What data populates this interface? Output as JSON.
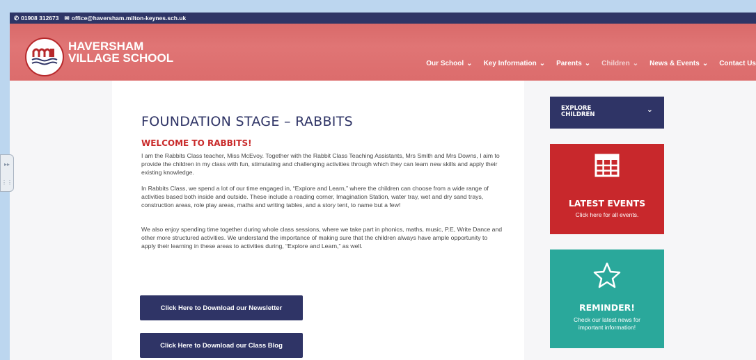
{
  "topbar": {
    "phone": "01908 312673",
    "email": "office@haversham.milton-keynes.sch.uk"
  },
  "header": {
    "school_line1": "HAVERSHAM",
    "school_line2": "VILLAGE SCHOOL"
  },
  "nav": {
    "items": [
      {
        "label": "Our School",
        "has_dropdown": true
      },
      {
        "label": "Key Information",
        "has_dropdown": true
      },
      {
        "label": "Parents",
        "has_dropdown": true
      },
      {
        "label": "Children",
        "has_dropdown": true
      },
      {
        "label": "News & Events",
        "has_dropdown": true
      },
      {
        "label": "Contact Us",
        "has_dropdown": false
      }
    ]
  },
  "main": {
    "title": "FOUNDATION STAGE – RABBITS",
    "welcome_heading": "WELCOME TO RABBITS!",
    "paragraphs": [
      "I am the Rabbits Class teacher, Miss McEvoy. Together with the Rabbit Class Teaching Assistants, Mrs Smith and Mrs Downs, I aim to provide the children in my class with fun, stimulating and challenging activities through which they can learn new skills and apply their existing knowledge.",
      "In Rabbits Class, we spend a lot of our time engaged in, “Explore and Learn,” where the children can choose from a wide range of activities based both inside and outside. These include a reading corner, Imagination Station, water tray, wet and dry sand trays, construction areas, role play areas, maths and writing tables, and a story tent, to name but a few!",
      "We also enjoy spending time together during whole class sessions, where we take part in phonics, maths, music, P.E, Write Dance and other more structured activities. We understand the importance of making sure that the children always have ample opportunity to apply their learning in these areas to activities during, “Explore and Learn,” as well."
    ],
    "buttons": {
      "newsletter": "Click Here to Download our Newsletter",
      "class_blog": "Click Here to Download our Class Blog"
    }
  },
  "sidebar": {
    "explore_line1": "EXPLORE",
    "explore_line2": "CHILDREN",
    "events_title": "LATEST EVENTS",
    "events_sub": "Click here for all events.",
    "reminder_title": "REMINDER!",
    "reminder_sub1": "Check our latest news for",
    "reminder_sub2": "important information!"
  },
  "colors": {
    "navy": "#2f3466",
    "header_red": "#dc6c6c",
    "events_red": "#c8282c",
    "reminder_teal": "#2aa89b"
  },
  "icons": [
    "phone-icon",
    "email-icon",
    "school-logo",
    "calendar-grid-icon",
    "star-icon",
    "chevron-down-icon"
  ]
}
